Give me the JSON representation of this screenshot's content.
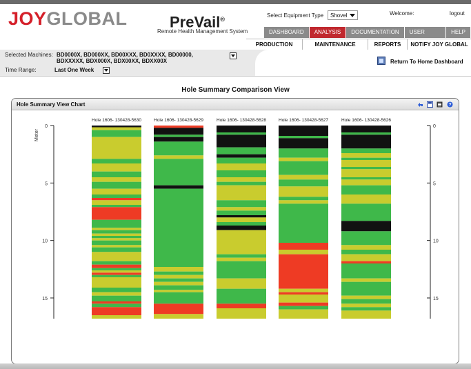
{
  "header": {
    "logo_text_red": "JOY",
    "logo_text_gray": "GLOBAL",
    "product": "PreVail",
    "product_mark": "®",
    "product_sub": "Remote Health Management System",
    "equip_type_label": "Select Equipment Type",
    "equip_type_value": "Shovel",
    "welcome": "Welcome:",
    "logout": "logout"
  },
  "nav": {
    "tabs": [
      {
        "label": "DASHBOARD",
        "active": false
      },
      {
        "label": "ANALYSIS",
        "active": true
      },
      {
        "label": "DOCUMENTATION",
        "active": false
      },
      {
        "label": "USER DETAILS",
        "active": false
      },
      {
        "label": "HELP",
        "active": false
      }
    ],
    "subtabs": [
      "PRODUCTION",
      "MAINTENANCE",
      "REPORTS",
      "NOTIFY JOY GLOBAL"
    ]
  },
  "filters": {
    "selected_machines_label": "Selected Machines:",
    "selected_machines_value": "BD0000X, BD000XX, BD00XXX, BD0XXXX, BD00000, BDXXXXX, BDX000X, BDX00XX, BDXX00X",
    "time_range_label": "Time Range:",
    "time_range_value": "Last One Week",
    "return_home": "Return To Home Dashboard"
  },
  "page_title": "Hole Summary Comparison View",
  "panel": {
    "title": "Hole Summary View Chart",
    "tools": [
      "back-icon",
      "save-icon",
      "export-icon",
      "help-icon"
    ]
  },
  "chart_data": {
    "type": "bar",
    "ylabel": "Meter",
    "ylim": [
      0,
      16.8
    ],
    "yticks": [
      0,
      5,
      10,
      15
    ],
    "colors": {
      "green": "#3fb84a",
      "yellow": "#c9cc2e",
      "red": "#ee3b24",
      "black": "#111111"
    },
    "series": [
      {
        "name": "Hole 1606- 130428-5630",
        "segments": [
          [
            "black",
            0,
            0.15
          ],
          [
            "yellow",
            0.15,
            0.4
          ],
          [
            "green",
            0.4,
            1.0
          ],
          [
            "yellow",
            1.0,
            2.9
          ],
          [
            "green",
            2.9,
            3.3
          ],
          [
            "yellow",
            3.3,
            4.0
          ],
          [
            "green",
            4.0,
            4.5
          ],
          [
            "yellow",
            4.5,
            4.9
          ],
          [
            "green",
            4.9,
            5.5
          ],
          [
            "yellow",
            5.5,
            6.0
          ],
          [
            "green",
            6.0,
            6.3
          ],
          [
            "red",
            6.3,
            6.5
          ],
          [
            "yellow",
            6.5,
            6.9
          ],
          [
            "green",
            6.9,
            7.1
          ],
          [
            "red",
            7.1,
            8.2
          ],
          [
            "green",
            8.2,
            8.9
          ],
          [
            "yellow",
            8.9,
            9.1
          ],
          [
            "green",
            9.1,
            9.4
          ],
          [
            "yellow",
            9.4,
            9.6
          ],
          [
            "green",
            9.6,
            9.8
          ],
          [
            "yellow",
            9.8,
            10.0
          ],
          [
            "green",
            10.0,
            10.4
          ],
          [
            "yellow",
            10.4,
            10.6
          ],
          [
            "green",
            10.6,
            11.0
          ],
          [
            "yellow",
            11.0,
            11.8
          ],
          [
            "green",
            11.8,
            12.1
          ],
          [
            "red",
            12.1,
            12.4
          ],
          [
            "green",
            12.4,
            12.6
          ],
          [
            "yellow",
            12.6,
            12.8
          ],
          [
            "red",
            12.8,
            13.0
          ],
          [
            "green",
            13.0,
            13.2
          ],
          [
            "yellow",
            13.2,
            14.1
          ],
          [
            "green",
            14.1,
            14.5
          ],
          [
            "yellow",
            14.5,
            14.8
          ],
          [
            "green",
            14.8,
            15.3
          ],
          [
            "red",
            15.3,
            15.5
          ],
          [
            "green",
            15.5,
            15.8
          ],
          [
            "red",
            15.8,
            16.5
          ],
          [
            "yellow",
            16.5,
            16.8
          ]
        ]
      },
      {
        "name": "Hole 1606- 130428-5629",
        "segments": [
          [
            "red",
            0,
            0.2
          ],
          [
            "black",
            0.2,
            0.8
          ],
          [
            "green",
            0.8,
            1.0
          ],
          [
            "black",
            1.0,
            1.4
          ],
          [
            "green",
            1.4,
            2.6
          ],
          [
            "yellow",
            2.6,
            2.9
          ],
          [
            "green",
            2.9,
            5.2
          ],
          [
            "black",
            5.2,
            5.5
          ],
          [
            "green",
            5.5,
            12.3
          ],
          [
            "yellow",
            12.3,
            12.7
          ],
          [
            "green",
            12.7,
            13.0
          ],
          [
            "yellow",
            13.0,
            13.3
          ],
          [
            "green",
            13.3,
            13.6
          ],
          [
            "yellow",
            13.6,
            13.9
          ],
          [
            "green",
            13.9,
            14.3
          ],
          [
            "yellow",
            14.3,
            14.5
          ],
          [
            "green",
            14.5,
            15.5
          ],
          [
            "red",
            15.5,
            16.4
          ],
          [
            "yellow",
            16.4,
            16.8
          ]
        ]
      },
      {
        "name": "Hole 1606- 130428-5628",
        "segments": [
          [
            "black",
            0,
            0.6
          ],
          [
            "green",
            0.6,
            0.8
          ],
          [
            "black",
            0.8,
            1.9
          ],
          [
            "green",
            1.9,
            2.5
          ],
          [
            "black",
            2.5,
            2.8
          ],
          [
            "green",
            2.8,
            3.3
          ],
          [
            "yellow",
            3.3,
            3.9
          ],
          [
            "green",
            3.9,
            4.5
          ],
          [
            "yellow",
            4.5,
            4.9
          ],
          [
            "green",
            4.9,
            5.2
          ],
          [
            "yellow",
            5.2,
            6.5
          ],
          [
            "green",
            6.5,
            7.1
          ],
          [
            "yellow",
            7.1,
            7.4
          ],
          [
            "green",
            7.4,
            7.8
          ],
          [
            "black",
            7.8,
            8.0
          ],
          [
            "yellow",
            8.0,
            8.4
          ],
          [
            "green",
            8.4,
            8.7
          ],
          [
            "black",
            8.7,
            9.1
          ],
          [
            "yellow",
            9.1,
            11.2
          ],
          [
            "green",
            11.2,
            11.5
          ],
          [
            "yellow",
            11.5,
            11.8
          ],
          [
            "green",
            11.8,
            13.3
          ],
          [
            "yellow",
            13.3,
            14.2
          ],
          [
            "green",
            14.2,
            15.5
          ],
          [
            "red",
            15.5,
            15.9
          ],
          [
            "yellow",
            15.9,
            16.8
          ]
        ]
      },
      {
        "name": "Hole 1606- 130428-5627",
        "segments": [
          [
            "black",
            0,
            0.9
          ],
          [
            "green",
            0.9,
            1.1
          ],
          [
            "black",
            1.1,
            2.0
          ],
          [
            "green",
            2.0,
            2.8
          ],
          [
            "yellow",
            2.8,
            3.1
          ],
          [
            "green",
            3.1,
            4.3
          ],
          [
            "yellow",
            4.3,
            4.7
          ],
          [
            "green",
            4.7,
            5.3
          ],
          [
            "yellow",
            5.3,
            6.2
          ],
          [
            "green",
            6.2,
            6.5
          ],
          [
            "yellow",
            6.5,
            6.8
          ],
          [
            "green",
            6.8,
            10.2
          ],
          [
            "red",
            10.2,
            10.8
          ],
          [
            "yellow",
            10.8,
            11.2
          ],
          [
            "red",
            11.2,
            14.2
          ],
          [
            "yellow",
            14.2,
            14.5
          ],
          [
            "red",
            14.5,
            14.7
          ],
          [
            "yellow",
            14.7,
            15.4
          ],
          [
            "red",
            15.4,
            15.7
          ],
          [
            "green",
            15.7,
            16.0
          ],
          [
            "yellow",
            16.0,
            16.8
          ]
        ]
      },
      {
        "name": "Hole 1606- 130428-5626",
        "segments": [
          [
            "black",
            0,
            0.6
          ],
          [
            "green",
            0.6,
            0.8
          ],
          [
            "black",
            0.8,
            2.0
          ],
          [
            "green",
            2.0,
            2.4
          ],
          [
            "yellow",
            2.4,
            2.8
          ],
          [
            "green",
            2.8,
            3.0
          ],
          [
            "yellow",
            3.0,
            3.6
          ],
          [
            "green",
            3.6,
            3.8
          ],
          [
            "yellow",
            3.8,
            4.5
          ],
          [
            "green",
            4.5,
            4.7
          ],
          [
            "yellow",
            4.7,
            5.2
          ],
          [
            "green",
            5.2,
            6.0
          ],
          [
            "yellow",
            6.0,
            6.8
          ],
          [
            "green",
            6.8,
            8.3
          ],
          [
            "black",
            8.3,
            9.2
          ],
          [
            "green",
            9.2,
            10.4
          ],
          [
            "yellow",
            10.4,
            10.8
          ],
          [
            "green",
            10.8,
            11.2
          ],
          [
            "yellow",
            11.2,
            11.8
          ],
          [
            "red",
            11.8,
            12.0
          ],
          [
            "green",
            12.0,
            13.3
          ],
          [
            "yellow",
            13.3,
            13.6
          ],
          [
            "green",
            13.6,
            14.8
          ],
          [
            "yellow",
            14.8,
            15.1
          ],
          [
            "green",
            15.1,
            15.5
          ],
          [
            "yellow",
            15.5,
            15.8
          ],
          [
            "green",
            15.8,
            16.1
          ],
          [
            "yellow",
            16.1,
            16.8
          ]
        ]
      }
    ]
  }
}
